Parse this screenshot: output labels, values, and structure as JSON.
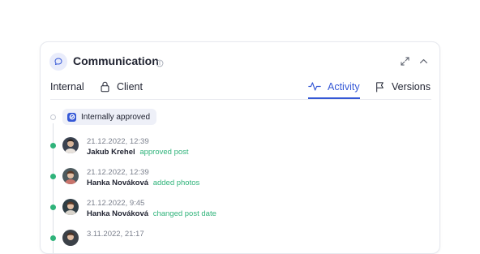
{
  "panel": {
    "title": "Communication",
    "icons": [
      "chat-icon",
      "info-icon",
      "expand-icon",
      "chevron-up-icon"
    ]
  },
  "tabs": [
    {
      "label": "Internal",
      "icon": null,
      "active": false
    },
    {
      "label": "Client",
      "icon": "lock-icon",
      "active": false
    },
    {
      "label": "Activity",
      "icon": "activity-icon",
      "active": true
    },
    {
      "label": "Versions",
      "icon": "flag-icon",
      "active": false
    }
  ],
  "status_badge": {
    "label": "Internally approved",
    "icon": "check-icon"
  },
  "activity": [
    {
      "date": "21.12.2022, 12:39",
      "author": "Jakub Krehel",
      "action": "approved post"
    },
    {
      "date": "21.12.2022, 12:39",
      "author": "Hanka Nováková",
      "action": "added photos"
    },
    {
      "date": "21.12.2022, 9:45",
      "author": "Hanka Nováková",
      "action": "changed post date"
    },
    {
      "date": "3.11.2022, 21:17",
      "author": "",
      "action": ""
    }
  ],
  "colors": {
    "accent": "#3558d6",
    "success": "#2fb37a",
    "muted": "#7a7f8c",
    "badge_bg": "#eef0f8"
  }
}
